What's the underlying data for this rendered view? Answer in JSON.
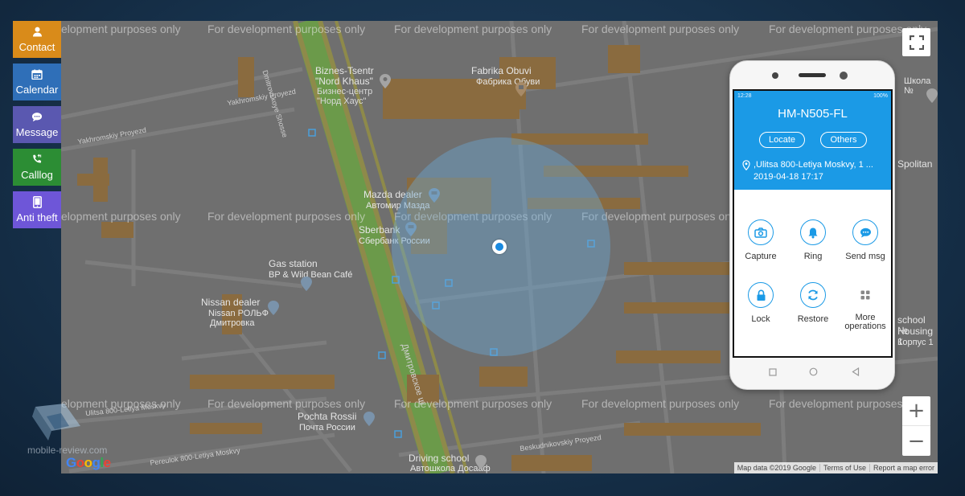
{
  "sidebar": {
    "items": [
      {
        "label": "Contact",
        "icon": "person-icon"
      },
      {
        "label": "Calendar",
        "icon": "calendar-icon"
      },
      {
        "label": "Message",
        "icon": "chat-icon"
      },
      {
        "label": "Calllog",
        "icon": "phone-icon"
      },
      {
        "label": "Anti theft",
        "icon": "tablet-icon"
      }
    ]
  },
  "map": {
    "watermark": "For development purposes only",
    "watermark_clipped": "elopment purposes only",
    "pois": {
      "biznes_en": "Biznes-Tsentr\n\"Nord Khaus\"",
      "biznes_ru": "Бизнес-центр\n\"Норд Хаус\"",
      "fabrika_en": "Fabrika Obuvi",
      "fabrika_ru": "Фабрика Обуви",
      "mazda_en": "Mazda dealer",
      "mazda_ru": "Автомир Мазда",
      "sberbank_en": "Sberbank",
      "sberbank_ru": "Сбербанк России",
      "gas_en": "Gas station",
      "gas_ru": "BP & Wild Bean Café",
      "nissan_en": "Nissan dealer",
      "nissan_ru1": "Nissan РОЛЬФ",
      "nissan_ru2": "Дмитровка",
      "pochta_en": "Pochta Rossii",
      "pochta_ru": "Почта России",
      "driving_en": "Driving school",
      "driving_ru": "Автошкола Досааф",
      "school_ru": "Школа №",
      "spolitan": "Spolitan",
      "school_en": "school №",
      "housing": "Housing 1",
      "korpus": "Корпус 1"
    },
    "streets": {
      "s1": "Yakhromskiy Proyezd",
      "s2": "Yakhromskiy Proyezd",
      "s3": "Dmitrovskoye Shosse",
      "s4": "Ulitsa 800-Letiya Moskvy",
      "s5": "Pereulok 800-Letiya Moskvy",
      "s6": "Beskudnikovskiy Proyezd",
      "s7": "Дмитровское ш"
    },
    "attribution": [
      "Map data ©2019 Google",
      "Terms of Use",
      "Report a map error"
    ],
    "google_letters": [
      "G",
      "o",
      "o",
      "g",
      "l",
      "e"
    ]
  },
  "phone": {
    "status_time": "12:28",
    "status_right": "100%",
    "device_name": "HM-N505-FL",
    "locate_label": "Locate",
    "others_label": "Others",
    "address": ",Ulitsa 800-Letiya Moskvy, 1 ...",
    "timestamp": "2019-04-18 17:17",
    "actions": [
      {
        "label": "Capture",
        "icon": "camera-icon"
      },
      {
        "label": "Ring",
        "icon": "bell-icon"
      },
      {
        "label": "Send msg",
        "icon": "message-icon"
      },
      {
        "label": "Lock",
        "icon": "lock-icon"
      },
      {
        "label": "Restore",
        "icon": "refresh-icon"
      },
      {
        "label": "More operations",
        "icon": "grid-icon"
      }
    ]
  },
  "watermark_site": "mobile-review.com",
  "colors": {
    "accent": "#1b9ae6",
    "contact": "#d98b1a",
    "calendar": "#2f6fb8",
    "message": "#5a58b0",
    "calllog": "#2c8d34",
    "antitheft": "#6e56d8"
  }
}
